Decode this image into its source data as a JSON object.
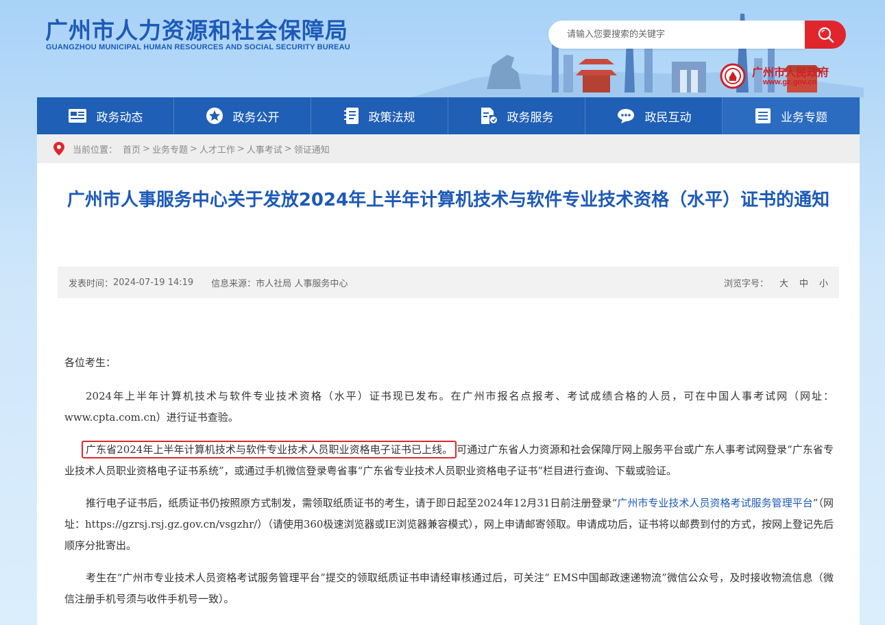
{
  "header": {
    "title_cn": "广州市人力资源和社会保障局",
    "title_en": "GUANGZHOU MUNICIPAL HUMAN RESOURCES AND SOCIAL SECURITY BUREAU",
    "search_placeholder": "请输入您要搜索的关键字",
    "gov_name": "广州市人民政府",
    "gov_url": "www.gz.gov.cn"
  },
  "nav": {
    "items": [
      {
        "label": "政务动态",
        "icon": "news-icon"
      },
      {
        "label": "政务公开",
        "icon": "star-icon"
      },
      {
        "label": "政策法规",
        "icon": "document-icon"
      },
      {
        "label": "政务服务",
        "icon": "service-icon"
      },
      {
        "label": "政民互动",
        "icon": "chat-icon"
      },
      {
        "label": "业务专题",
        "icon": "list-icon"
      }
    ]
  },
  "breadcrumb": {
    "prefix": "当前位置：",
    "items": [
      "首页",
      "业务专题",
      "人才工作",
      "人事考试",
      "领证通知"
    ],
    "sep": ">"
  },
  "article": {
    "title": "广州市人事服务中心关于发放2024年上半年计算机技术与软件专业技术资格（水平）证书的通知",
    "meta": {
      "date_label": "发表时间：",
      "date": "2024-07-19 14:19",
      "source_label": "信息来源：",
      "source": "市人社局 人事服务中心",
      "font_label": "浏览字号：",
      "font_sizes": [
        "大",
        "中",
        "小"
      ]
    },
    "greeting": "各位考生：",
    "p1": "2024年上半年计算机技术与软件专业技术资格（水平）证书现已发布。在广州市报名点报考、考试成绩合格的人员，可在中国人事考试网（网址：www.cpta.com.cn）进行证书查验。",
    "p2_highlight": "广东省2024年上半年计算机技术与软件专业技术人员职业资格电子证书已上线。",
    "p2_rest": "可通过广东省人力资源和社会保障厅网上服务平台或广东人事考试网登录“广东省专业技术人员职业资格电子证书系统”，或通过手机微信登录粤省事“广东省专业技术人员职业资格电子证书”栏目进行查询、下载或验证。",
    "p3_a": "推行电子证书后，纸质证书仍按照原方式制发，需领取纸质证书的考生，请于即日起至2024年12月31日前注册登录“",
    "p3_link": "广州市专业技术人员资格考试服务管理平台",
    "p3_b": "”（网址：https://gzrsj.rsj.gz.gov.cn/vsgzhr/）（请使用360极速浏览器或IE浏览器兼容模式），网上申请邮寄领取。申请成功后，证书将以邮费到付的方式，按网上登记先后顺序分批寄出。",
    "p4": "考生在“广州市专业技术人员资格考试服务管理平台”提交的领取纸质证书申请经审核通过后，可关注“ EMS中国邮政速递物流”微信公众号，及时接收物流信息（微信注册手机号须与收件手机号一致）。"
  },
  "colors": {
    "primary": "#1f5fb5",
    "title_blue": "#1d5ab8",
    "accent_red": "#e0262c"
  }
}
